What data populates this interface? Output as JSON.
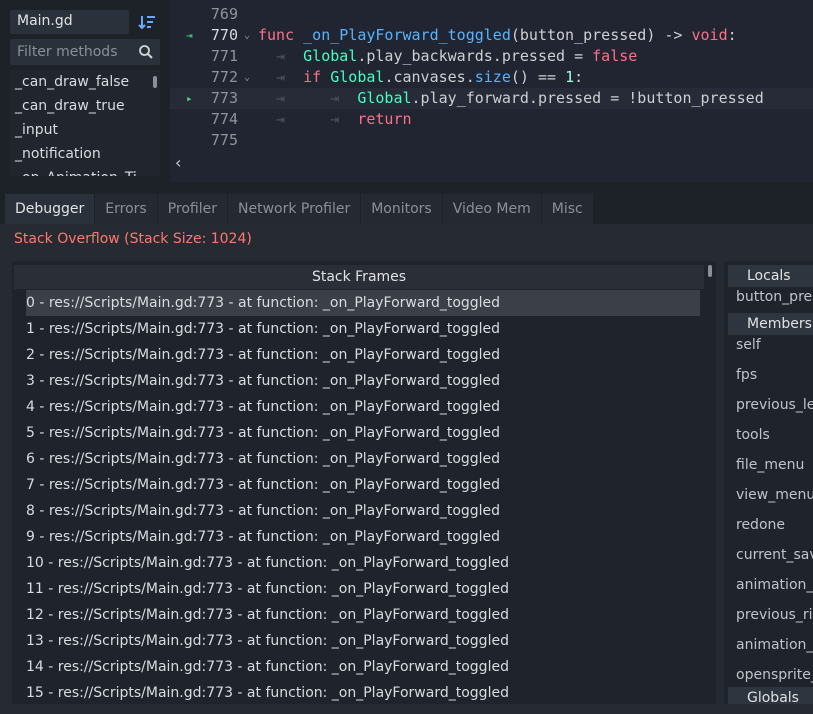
{
  "script_panel": {
    "current_script": "Main.gd",
    "filter_placeholder": "Filter methods",
    "methods": [
      "_can_draw_false",
      "_can_draw_true",
      "_input",
      "_notification",
      "_on_Animation_Ti..."
    ]
  },
  "editor": {
    "lines": [
      {
        "num": "769",
        "fold": "",
        "tokens": []
      },
      {
        "num": "770",
        "fold": "⌄",
        "tokens": [
          {
            "t": "func",
            "c": "kw"
          },
          {
            "t": " ",
            "c": "tx"
          },
          {
            "t": "_on_PlayForward_toggled",
            "c": "fn"
          },
          {
            "t": "(button_pressed) -> ",
            "c": "tx"
          },
          {
            "t": "void",
            "c": "kw"
          },
          {
            "t": ":",
            "c": "tx"
          }
        ]
      },
      {
        "num": "771",
        "fold": "",
        "tokens": [
          {
            "t": "  ⇥  ",
            "c": "tab-arrow"
          },
          {
            "t": "Global",
            "c": "bi"
          },
          {
            "t": ".play_backwards.pressed = ",
            "c": "tx"
          },
          {
            "t": "false",
            "c": "kw"
          }
        ]
      },
      {
        "num": "772",
        "fold": "⌄",
        "tokens": [
          {
            "t": "  ⇥  ",
            "c": "tab-arrow"
          },
          {
            "t": "if",
            "c": "kw"
          },
          {
            "t": " ",
            "c": "tx"
          },
          {
            "t": "Global",
            "c": "bi"
          },
          {
            "t": ".canvases.",
            "c": "tx"
          },
          {
            "t": "size",
            "c": "fn"
          },
          {
            "t": "() == ",
            "c": "tx"
          },
          {
            "t": "1",
            "c": "nm"
          },
          {
            "t": ":",
            "c": "tx"
          }
        ]
      },
      {
        "num": "773",
        "fold": "",
        "tokens": [
          {
            "t": "  ⇥     ⇥  ",
            "c": "tab-arrow"
          },
          {
            "t": "Global",
            "c": "bi"
          },
          {
            "t": ".play_forward.pressed = !button_pressed",
            "c": "tx"
          }
        ]
      },
      {
        "num": "774",
        "fold": "",
        "tokens": [
          {
            "t": "  ⇥     ⇥  ",
            "c": "tab-arrow"
          },
          {
            "t": "return",
            "c": "kw"
          }
        ]
      },
      {
        "num": "775",
        "fold": "",
        "tokens": []
      }
    ]
  },
  "bottom_panel": {
    "tabs": [
      "Debugger",
      "Errors",
      "Profiler",
      "Network Profiler",
      "Monitors",
      "Video Mem",
      "Misc"
    ],
    "active_tab": "Debugger",
    "error_message": "Stack Overflow (Stack Size: 1024)",
    "stack_frames_header": "Stack Frames",
    "frames": [
      "0 - res://Scripts/Main.gd:773 - at function: _on_PlayForward_toggled",
      "1 - res://Scripts/Main.gd:773 - at function: _on_PlayForward_toggled",
      "2 - res://Scripts/Main.gd:773 - at function: _on_PlayForward_toggled",
      "3 - res://Scripts/Main.gd:773 - at function: _on_PlayForward_toggled",
      "4 - res://Scripts/Main.gd:773 - at function: _on_PlayForward_toggled",
      "5 - res://Scripts/Main.gd:773 - at function: _on_PlayForward_toggled",
      "6 - res://Scripts/Main.gd:773 - at function: _on_PlayForward_toggled",
      "7 - res://Scripts/Main.gd:773 - at function: _on_PlayForward_toggled",
      "8 - res://Scripts/Main.gd:773 - at function: _on_PlayForward_toggled",
      "9 - res://Scripts/Main.gd:773 - at function: _on_PlayForward_toggled",
      "10 - res://Scripts/Main.gd:773 - at function: _on_PlayForward_toggled",
      "11 - res://Scripts/Main.gd:773 - at function: _on_PlayForward_toggled",
      "12 - res://Scripts/Main.gd:773 - at function: _on_PlayForward_toggled",
      "13 - res://Scripts/Main.gd:773 - at function: _on_PlayForward_toggled",
      "14 - res://Scripts/Main.gd:773 - at function: _on_PlayForward_toggled",
      "15 - res://Scripts/Main.gd:773 - at function: _on_PlayForward_toggled"
    ],
    "inspector": {
      "locals_label": "Locals",
      "locals": [
        "button_pres"
      ],
      "members_label": "Members",
      "members": [
        "self",
        "fps",
        "previous_le",
        "tools",
        "file_menu",
        "view_menu",
        "redone",
        "current_sav",
        "animation_f",
        "previous_ri",
        "animation_l",
        "opensprite_"
      ],
      "globals_label": "Globals"
    }
  },
  "colors": {
    "error": "#ff786b",
    "keyword": "#ff7085",
    "function": "#57b3ff",
    "builtin": "#42ffc2"
  }
}
